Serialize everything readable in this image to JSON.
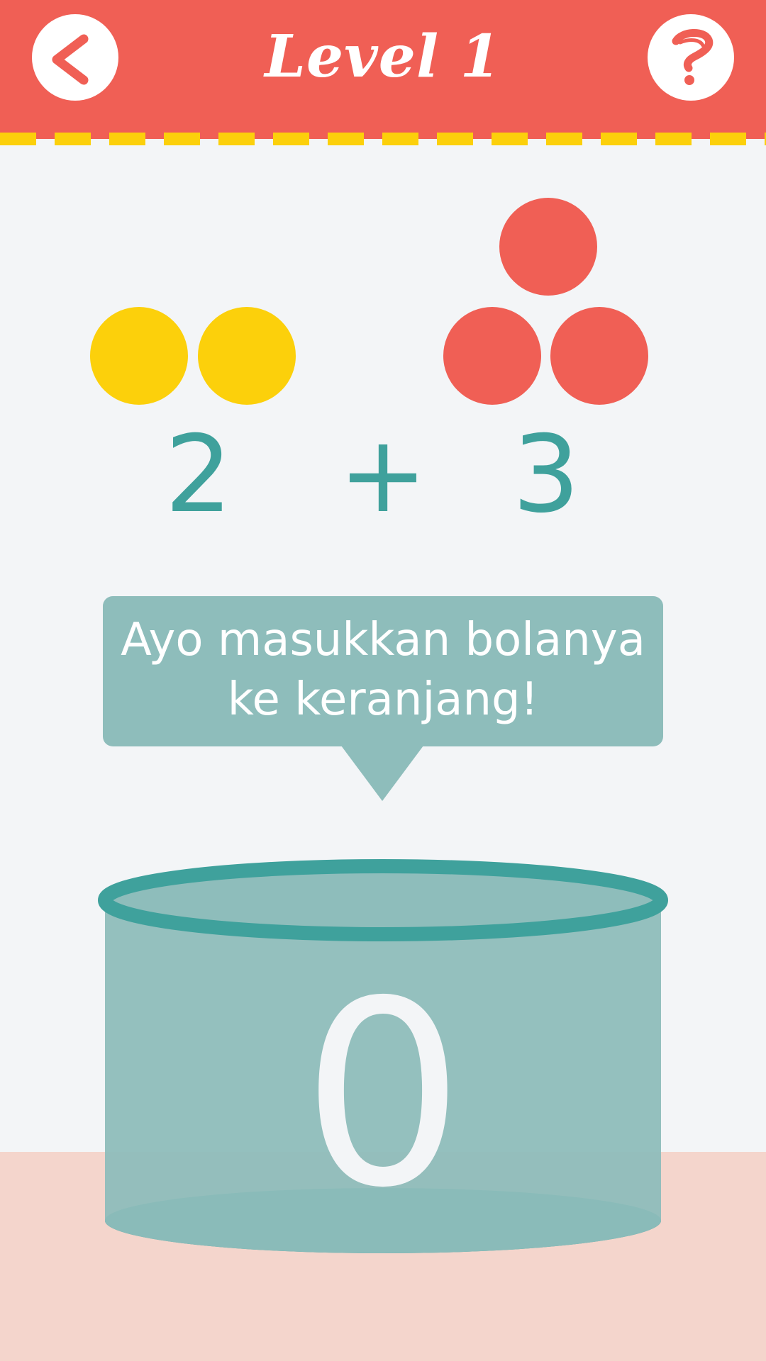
{
  "header": {
    "title": "Level 1",
    "back_icon": "chevron-left-icon",
    "help_icon": "question-icon"
  },
  "colors": {
    "header_red": "#f05f55",
    "dash_yellow": "#fcd00b",
    "teal": "#3fa19c",
    "teal_light": "#8ebdbb",
    "background": "#f3f5f7",
    "floor": "#f4d5cc"
  },
  "equation": {
    "left_count": "2",
    "operator": "+",
    "right_count": "3",
    "left_ball_color": "yellow",
    "right_ball_color": "red"
  },
  "instruction": {
    "line1": "Ayo masukkan bolanya",
    "line2": "ke keranjang!"
  },
  "basket": {
    "count": "0"
  }
}
